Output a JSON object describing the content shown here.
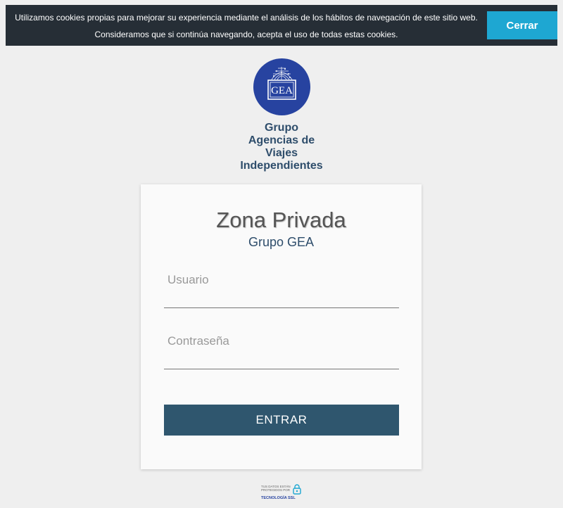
{
  "cookie_banner": {
    "line1": "Utilizamos cookies propias para mejorar su experiencia mediante el análisis de los hábitos de navegación de este sitio web.",
    "line2": "Consideramos que si continúa navegando, acepta el uso de todas estas cookies.",
    "close_label": "Cerrar"
  },
  "logo": {
    "mark_text": "GEA",
    "caption_lines": [
      "Grupo",
      "Agencias de",
      "Viajes",
      "Independientes"
    ]
  },
  "login": {
    "title": "Zona Privada",
    "subtitle": "Grupo GEA",
    "username_placeholder": "Usuario",
    "username_value": "",
    "password_placeholder": "Contraseña",
    "password_value": "",
    "submit_label": "ENTRAR"
  },
  "ssl_badge": {
    "line1": "TUS DATOS ESTÁN",
    "line2": "PROTEGIDOS POR",
    "main": "TECNOLOGÍA SSL",
    "icon": "lock-icon"
  },
  "colors": {
    "banner_bg": "#262e36",
    "close_button": "#1ea7d2",
    "logo_blue": "#2743a0",
    "primary_button": "#2f566e",
    "heading_blue": "#2e4d6b",
    "page_bg": "#efefef"
  }
}
